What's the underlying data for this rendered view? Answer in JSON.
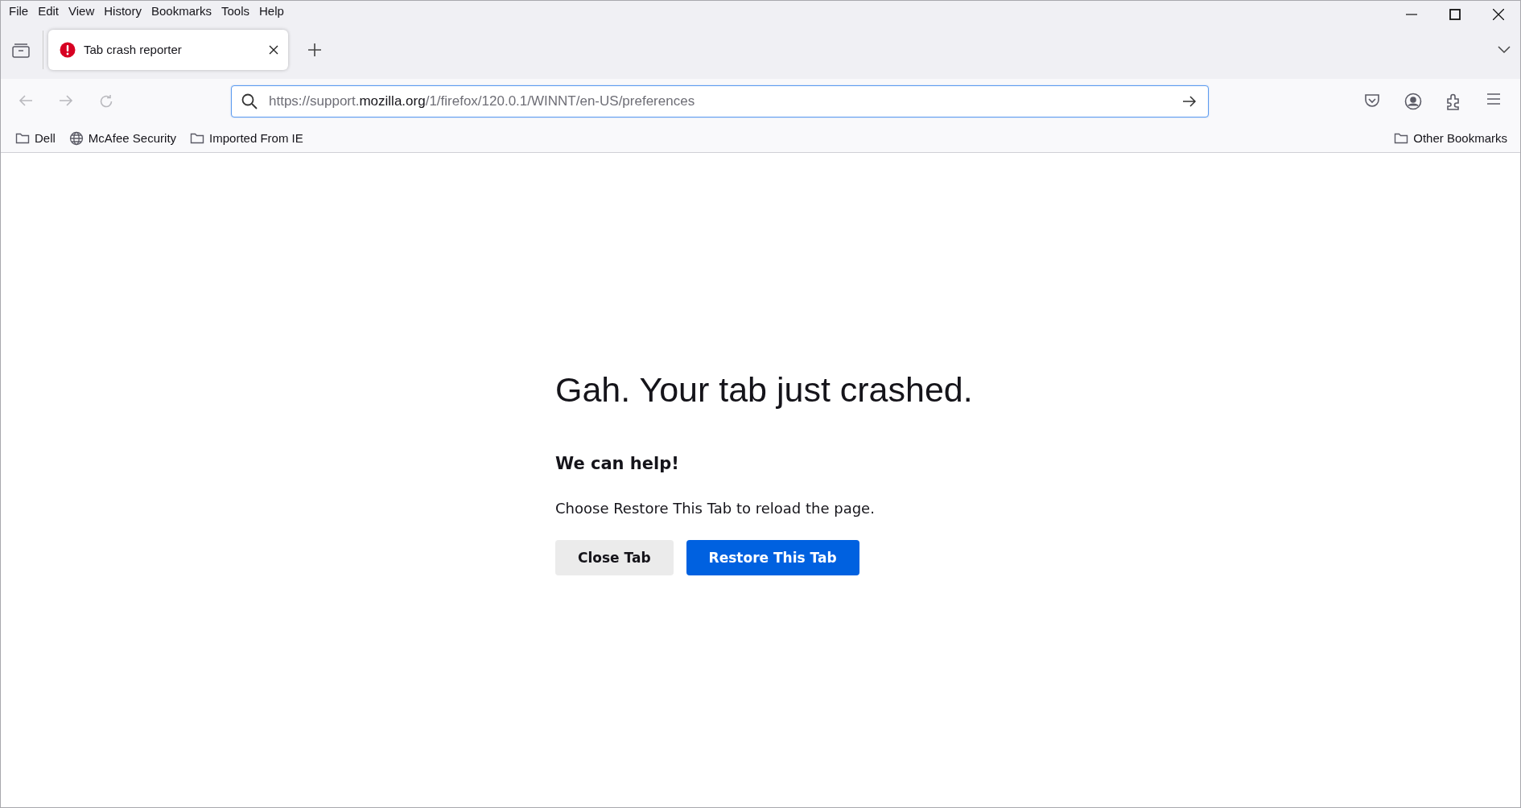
{
  "menu_bar": {
    "items": [
      "File",
      "Edit",
      "View",
      "History",
      "Bookmarks",
      "Tools",
      "Help"
    ]
  },
  "tab_strip": {
    "tabs": [
      {
        "title": "Tab crash reporter",
        "selected": true
      }
    ]
  },
  "nav_buttons": [
    {
      "kind": "back",
      "disabled": true
    },
    {
      "kind": "forward",
      "disabled": true
    },
    {
      "kind": "reload",
      "disabled": true
    }
  ],
  "address_bar": {
    "url_parts": [
      {
        "text": "https://support.",
        "emphasis": false
      },
      {
        "text": "mozilla.org",
        "emphasis": true
      },
      {
        "text": "/1/firefox/120.0.1/WINNT/en-US/preferences",
        "emphasis": false
      }
    ]
  },
  "bookmarks_bar": {
    "items": [
      {
        "label": "Dell",
        "kind": "folder"
      },
      {
        "label": "McAfee Security",
        "kind": "site"
      },
      {
        "label": "Imported From IE",
        "kind": "folder"
      }
    ],
    "other": {
      "label": "Other Bookmarks",
      "kind": "folder"
    }
  },
  "page": {
    "heading": "Gah. Your tab just crashed.",
    "subheading": "We can help!",
    "message": "Choose Restore This Tab to reload the page.",
    "buttons": [
      {
        "label": "Close Tab",
        "kind": "secondary"
      },
      {
        "label": "Restore This Tab",
        "kind": "primary"
      }
    ]
  }
}
